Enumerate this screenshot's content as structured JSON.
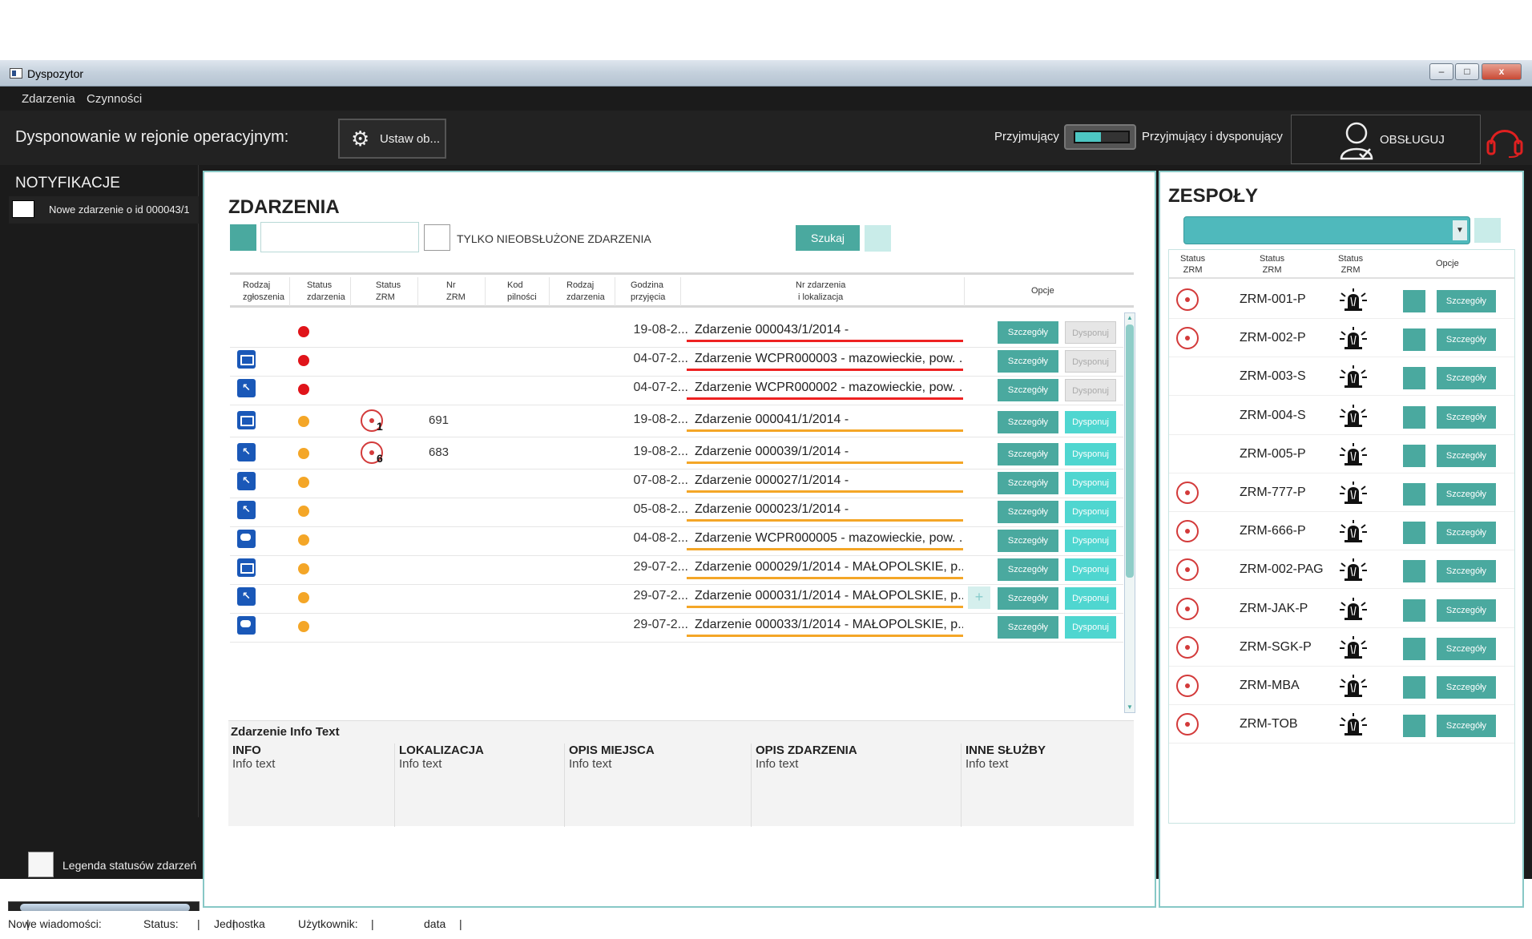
{
  "window": {
    "title": "Dyspozytor",
    "min": "–",
    "max": "□",
    "close": "x"
  },
  "menu": [
    "Zdarzenia",
    "Czynności"
  ],
  "topbar": {
    "label": "Dysponowanie w rejonie operacyjnym:",
    "ustaw_label": "Ustaw ob...",
    "przyjmujacy": "Przyjmujący",
    "przyjmujacy_dysponujacy": "Przyjmujący i dysponujący",
    "obsluguj": "OBSŁUGUJ"
  },
  "notifications": {
    "header": "NOTYFIKACJE",
    "items": [
      "Nowe zdarzenie o id 000043/1"
    ],
    "legend": "Legenda statusów zdarzeń"
  },
  "events": {
    "title": "ZDARZENIA",
    "only_unhandled": "TYLKO NIEOBSŁUŻONE ZDARZENIA",
    "search_button": "Szukaj",
    "columns": [
      "Rodzaj\nzgłoszenia",
      "Status\nzdarzenia",
      "Status\nZRM",
      "Nr\nZRM",
      "Kod\npilności",
      "Rodzaj\nzdarzenia",
      "Godzina\nprzyjęcia",
      "Nr zdarzenia\ni lokalizacja",
      "Opcje"
    ],
    "details_label": "Szczegóły",
    "dispatch_label": "Dysponuj",
    "plus_label": "+",
    "rows": [
      {
        "kind": "",
        "status": "red",
        "zrm": "",
        "nr_zrm": "",
        "time": "19-08-2...",
        "loc": "Zdarzenie 000043/1/2014 -",
        "dispatch": false,
        "plus": false
      },
      {
        "kind": "env",
        "status": "red",
        "zrm": "",
        "nr_zrm": "",
        "time": "04-07-2...",
        "loc": "Zdarzenie WCPR000003 - mazowieckie, pow. ...",
        "dispatch": false,
        "plus": false
      },
      {
        "kind": "cursor",
        "status": "red",
        "zrm": "",
        "nr_zrm": "",
        "time": "04-07-2...",
        "loc": "Zdarzenie WCPR000002 - mazowieckie, pow. ...",
        "dispatch": false,
        "plus": false
      },
      {
        "kind": "env",
        "status": "orange",
        "zrm": "1",
        "nr_zrm": "691",
        "time": "19-08-2...",
        "loc": "Zdarzenie 000041/1/2014 -",
        "dispatch": true,
        "plus": false
      },
      {
        "kind": "cursor",
        "status": "orange",
        "zrm": "6",
        "nr_zrm": "683",
        "time": "19-08-2...",
        "loc": "Zdarzenie 000039/1/2014 -",
        "dispatch": true,
        "plus": false
      },
      {
        "kind": "cursor",
        "status": "orange",
        "zrm": "",
        "nr_zrm": "",
        "time": "07-08-2...",
        "loc": "Zdarzenie 000027/1/2014 -",
        "dispatch": true,
        "plus": false
      },
      {
        "kind": "cursor",
        "status": "orange",
        "zrm": "",
        "nr_zrm": "",
        "time": "05-08-2...",
        "loc": "Zdarzenie 000023/1/2014 -",
        "dispatch": true,
        "plus": false
      },
      {
        "kind": "chat",
        "status": "orange",
        "zrm": "",
        "nr_zrm": "",
        "time": "04-08-2...",
        "loc": "Zdarzenie WCPR000005 - mazowieckie, pow. ...",
        "dispatch": true,
        "plus": false
      },
      {
        "kind": "env",
        "status": "orange",
        "zrm": "",
        "nr_zrm": "",
        "time": "29-07-2...",
        "loc": "Zdarzenie 000029/1/2014 - MAŁOPOLSKIE, p...",
        "dispatch": true,
        "plus": false
      },
      {
        "kind": "cursor",
        "status": "orange",
        "zrm": "",
        "nr_zrm": "",
        "time": "29-07-2...",
        "loc": "Zdarzenie 000031/1/2014 - MAŁOPOLSKIE, p...",
        "dispatch": true,
        "plus": true
      },
      {
        "kind": "chat",
        "status": "orange",
        "zrm": "",
        "nr_zrm": "",
        "time": "29-07-2...",
        "loc": "Zdarzenie 000033/1/2014 - MAŁOPOLSKIE, p...",
        "dispatch": true,
        "plus": false
      }
    ],
    "info": {
      "header": "Zdarzenie Info Text",
      "columns": [
        {
          "title": "INFO",
          "value": "Info text"
        },
        {
          "title": "LOKALIZACJA",
          "value": "Info text"
        },
        {
          "title": "OPIS MIEJSCA",
          "value": "Info text"
        },
        {
          "title": "OPIS ZDARZENIA",
          "value": "Info text"
        },
        {
          "title": "INNE SŁUŻBY",
          "value": "Info text"
        }
      ]
    }
  },
  "teams": {
    "title": "ZESPOŁY",
    "columns": [
      "Status\nZRM",
      "Status\nZRM",
      "Status\nZRM",
      "Opcje"
    ],
    "details_label": "Szczegóły",
    "rows": [
      {
        "name": "ZRM-001-P",
        "status": true
      },
      {
        "name": "ZRM-002-P",
        "status": true
      },
      {
        "name": "ZRM-003-S",
        "status": false
      },
      {
        "name": "ZRM-004-S",
        "status": false
      },
      {
        "name": "ZRM-005-P",
        "status": false
      },
      {
        "name": "ZRM-777-P",
        "status": true
      },
      {
        "name": "ZRM-666-P",
        "status": true
      },
      {
        "name": "ZRM-002-PAG",
        "status": true
      },
      {
        "name": "ZRM-JAK-P",
        "status": true
      },
      {
        "name": "ZRM-SGK-P",
        "status": true
      },
      {
        "name": "ZRM-MBA",
        "status": true
      },
      {
        "name": "ZRM-TOB",
        "status": true
      }
    ]
  },
  "statusbar": [
    "Nowe wiadomości:",
    "|",
    "Status:",
    "|",
    "Jednostka",
    "|",
    "Użytkownik:",
    "|",
    "data",
    "|"
  ],
  "colors": {
    "accent": "#4aa99f",
    "red": "#e0141a",
    "orange": "#f4a627",
    "dark": "#1b1b1b"
  }
}
